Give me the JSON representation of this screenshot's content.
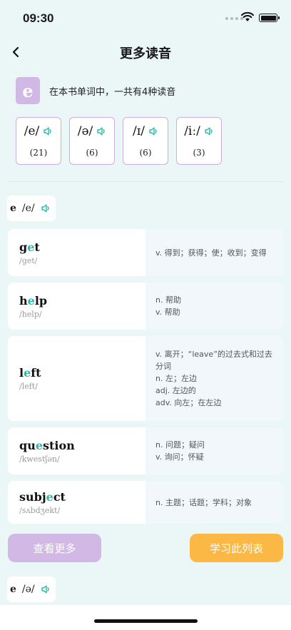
{
  "status": {
    "time": "09:30"
  },
  "nav": {
    "title": "更多读音"
  },
  "letter": {
    "char": "e",
    "description": "在本书单词中，一共有4种读音"
  },
  "pronunciations": [
    {
      "ipa": "/e/",
      "count": "(21)"
    },
    {
      "ipa": "/ə/",
      "count": "(6)"
    },
    {
      "ipa": "/ɪ/",
      "count": "(6)"
    },
    {
      "ipa": "/iː/",
      "count": "(3)"
    }
  ],
  "section1": {
    "letter": "e",
    "ipa": "/e/"
  },
  "words": [
    {
      "pre": "g",
      "hl": "e",
      "post": "t",
      "ipa": "/get/",
      "defs": [
        "v. 得到；获得；使；收到；变得"
      ]
    },
    {
      "pre": "h",
      "hl": "e",
      "post": "lp",
      "ipa": "/help/",
      "defs": [
        "n. 帮助",
        "v. 帮助"
      ]
    },
    {
      "pre": "l",
      "hl": "e",
      "post": "ft",
      "ipa": "/left/",
      "defs": [
        "v. 离开；“leave”的过去式和过去分词",
        "n. 左；左边",
        "adj. 左边的",
        "adv. 向左；在左边"
      ]
    },
    {
      "pre": "qu",
      "hl": "e",
      "post": "stion",
      "ipa": "/kwestʃən/",
      "defs": [
        "n. 问题；疑问",
        "v. 询问；怀疑"
      ]
    },
    {
      "pre": "subj",
      "hl": "e",
      "post": "ct",
      "ipa": "/sʌbdʒekt/",
      "defs": [
        "n. 主题；话题；学科；对象"
      ]
    }
  ],
  "buttons": {
    "more": "查看更多",
    "study": "学习此列表"
  },
  "section2": {
    "letter": "e",
    "ipa": "/ə/"
  },
  "colors": {
    "accent": "#2cb9a9",
    "purple": "#d2b8e4",
    "orange": "#fbb845",
    "background": "#eaf7f6"
  }
}
